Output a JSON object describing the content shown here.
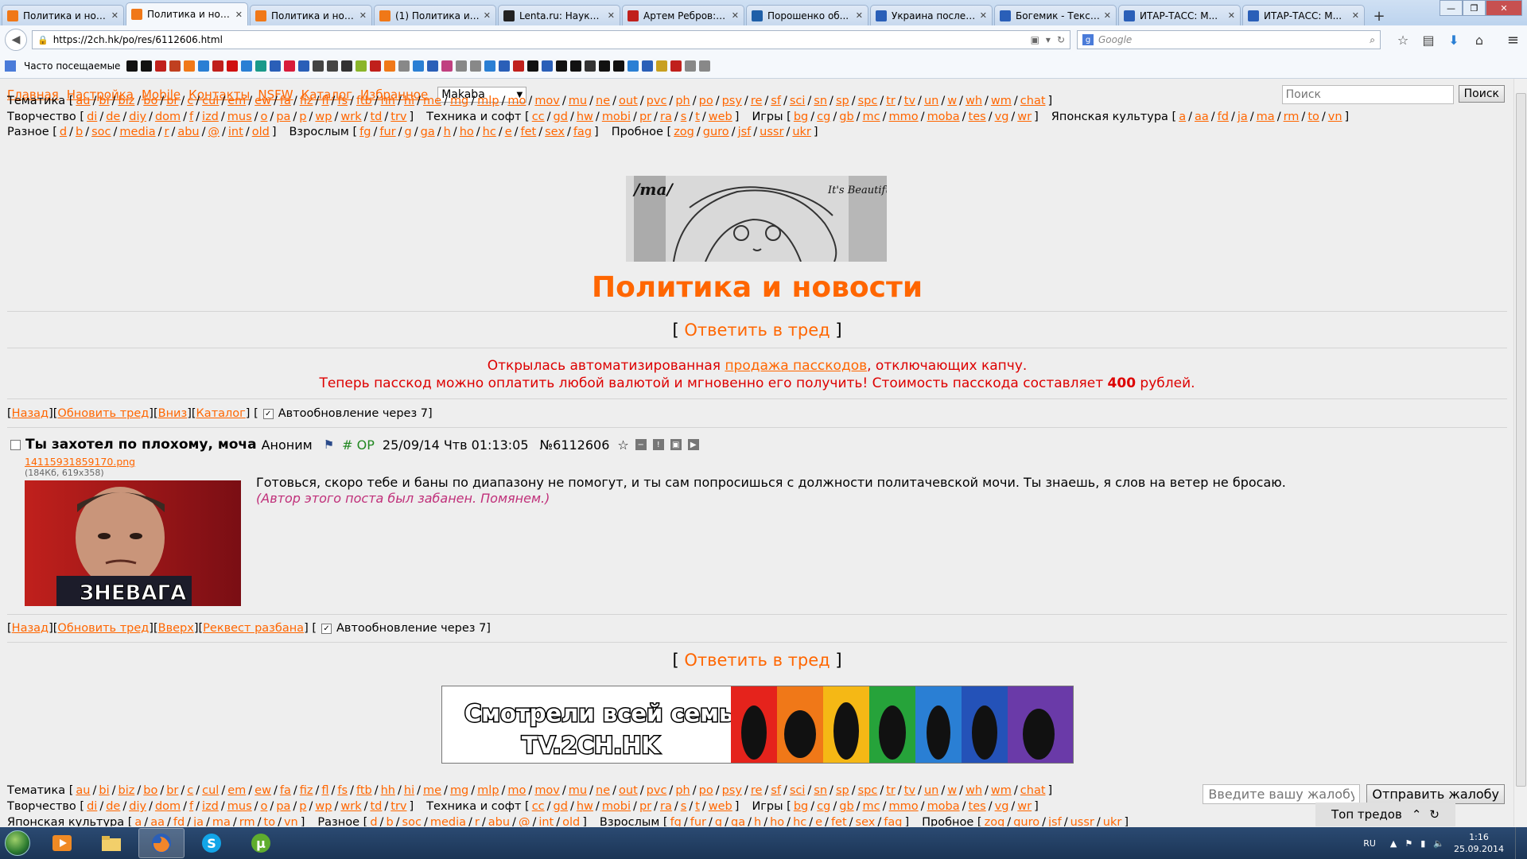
{
  "browser": {
    "tabs": [
      {
        "title": "Политика и нов...",
        "active": false
      },
      {
        "title": "Политика и нов...",
        "active": true
      },
      {
        "title": "Политика и нов...",
        "active": false
      },
      {
        "title": "(1) Политика и ...",
        "active": false
      },
      {
        "title": "Lenta.ru: Наука ...",
        "active": false
      },
      {
        "title": "Артем Ребров: \"...",
        "active": false
      },
      {
        "title": "Порошенко об...",
        "active": false
      },
      {
        "title": "Украина послед...",
        "active": false
      },
      {
        "title": "Богемик - Текст...",
        "active": false
      },
      {
        "title": "ИТАР-ТАСС: М...",
        "active": false
      },
      {
        "title": "ИТАР-ТАСС: М...",
        "active": false
      }
    ],
    "url": "https://2ch.hk/po/res/6112606.html",
    "search_placeholder": "Google",
    "bookmarks_label": "Часто посещаемые"
  },
  "site": {
    "menu": [
      "Главная",
      "Настройка",
      "Mobile",
      "Контакты",
      "NSFW",
      "Каталог",
      "Избранное"
    ],
    "skin_value": "Makaba",
    "search_placeholder": "Поиск",
    "search_button": "Поиск",
    "boardlist": [
      [
        {
          "name": "Тематика",
          "boards": [
            "au",
            "bi",
            "biz",
            "bo",
            "br",
            "c",
            "cul",
            "em",
            "ew",
            "fa",
            "fiz",
            "fl",
            "fs",
            "ftb",
            "hh",
            "hi",
            "me",
            "mg",
            "mlp",
            "mo",
            "mov",
            "mu",
            "ne",
            "out",
            "pvc",
            "ph",
            "po",
            "psy",
            "re",
            "sf",
            "sci",
            "sn",
            "sp",
            "spc",
            "tr",
            "tv",
            "un",
            "w",
            "wh",
            "wm",
            "chat"
          ]
        }
      ],
      [
        {
          "name": "Творчество",
          "boards": [
            "di",
            "de",
            "diy",
            "dom",
            "f",
            "izd",
            "mus",
            "o",
            "pa",
            "p",
            "wp",
            "wrk",
            "td",
            "trv"
          ]
        },
        {
          "name": "Техника и софт",
          "boards": [
            "cc",
            "gd",
            "hw",
            "mobi",
            "pr",
            "ra",
            "s",
            "t",
            "web"
          ]
        },
        {
          "name": "Игры",
          "boards": [
            "bg",
            "cg",
            "gb",
            "mc",
            "mmo",
            "moba",
            "tes",
            "vg",
            "wr"
          ]
        },
        {
          "name": "Японская культура",
          "boards": [
            "a",
            "aa",
            "fd",
            "ja",
            "ma",
            "rm",
            "to",
            "vn"
          ]
        }
      ],
      [
        {
          "name": "Разное",
          "boards": [
            "d",
            "b",
            "soc",
            "media",
            "r",
            "abu",
            "@",
            "int",
            "old"
          ]
        },
        {
          "name": "Взрослым",
          "boards": [
            "fg",
            "fur",
            "g",
            "ga",
            "h",
            "ho",
            "hc",
            "e",
            "fet",
            "sex",
            "fag"
          ]
        },
        {
          "name": "Пробное",
          "boards": [
            "zog",
            "guro",
            "jsf",
            "ussr",
            "ukr"
          ]
        }
      ]
    ],
    "banner_text_left": "/ma/",
    "banner_text_right": "It's Beautiful",
    "board_title": "Политика и новости",
    "reply_label": "Ответить в тред",
    "notice": {
      "line1_before": "Открылась автоматизированная ",
      "line1_link": "продажа пасскодов",
      "line1_after": ", отключающих капчу.",
      "line2_before": "Теперь пасскод можно оплатить любой валютой и мгновенно его получить! Стоимость пасскода составляет ",
      "line2_bold": "400",
      "line2_after": " рублей."
    },
    "threadnav_top": {
      "back": "Назад",
      "refresh": "Обновить тред",
      "down": "Вниз",
      "catalog": "Каталог",
      "auto": "Автообновление через 7"
    },
    "threadnav_bottom": {
      "back": "Назад",
      "refresh": "Обновить тред",
      "up": "Вверх",
      "unban": "Реквест разбана",
      "auto": "Автообновление через 7"
    },
    "post": {
      "subject": "Ты захотел по плохому, моча",
      "name": "Аноним",
      "op": "# OP",
      "date": "25/09/14 Чтв 01:13:05",
      "number": "№6112606",
      "filename": "14115931859170.png",
      "filemeta": "(184Кб, 619x358)",
      "image_caption": "ЗНЕВАГА",
      "text": "Готовься, скоро тебе и баны по диапазону не помогут, и ты сам попросишься с должности политачевской мочи. Ты знаешь, я слов на ветер не бросаю.",
      "ban_note": "(Автор этого поста был забанен. Помянем.)"
    },
    "ad": {
      "line1": "Смотрели всей семьей",
      "line2": "TV.2CH.HK"
    },
    "complaint_placeholder": "Введите вашу жалобу",
    "complaint_button": "Отправить жалобу",
    "top_threads": "Топ тредов"
  },
  "taskbar": {
    "lang": "RU",
    "time": "1:16",
    "date": "25.09.2014"
  }
}
